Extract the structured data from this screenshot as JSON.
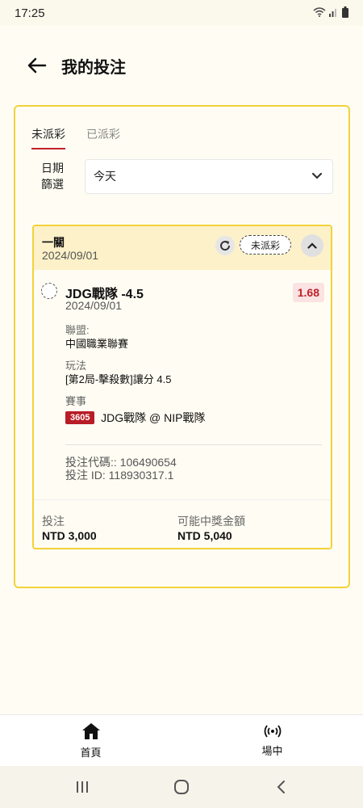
{
  "status_bar": {
    "time": "17:25",
    "icons": [
      "wifi-icon",
      "signal-icon",
      "battery-icon"
    ]
  },
  "header": {
    "title": "我的投注",
    "back_icon": "arrow-left-icon"
  },
  "tabs": [
    {
      "label": "未派彩",
      "active": true
    },
    {
      "label": "已派彩",
      "active": false
    }
  ],
  "filter": {
    "label": "日期篩選",
    "selected": "今天"
  },
  "bet": {
    "type": "一關",
    "date": "2024/09/01",
    "status": "未派彩",
    "selection": "JDG戰隊 -4.5",
    "selection_date": "2024/09/01",
    "odds": "1.68",
    "league_label": "聯盟:",
    "league": "中國職業聯賽",
    "market_label": "玩法",
    "market": "[第2局-擊殺數]讓分 4.5",
    "event_label": "賽事",
    "event_id": "3605",
    "event_name": "JDG戰隊 @ NIP戰隊",
    "bet_code": "投注代碼:: 106490654",
    "bet_id": "投注 ID: 118930317.1",
    "stake_label": "投注",
    "stake": "NTD 3,000",
    "payout_label": "可能中獎金額",
    "payout": "NTD 5,040"
  },
  "bottom_nav": [
    {
      "label": "首頁",
      "icon": "home-icon"
    },
    {
      "label": "場中",
      "icon": "live-broadcast-icon"
    }
  ],
  "colors": {
    "accent": "#c0222a",
    "border": "#f2d23a",
    "card_header": "#fcf1c8"
  }
}
